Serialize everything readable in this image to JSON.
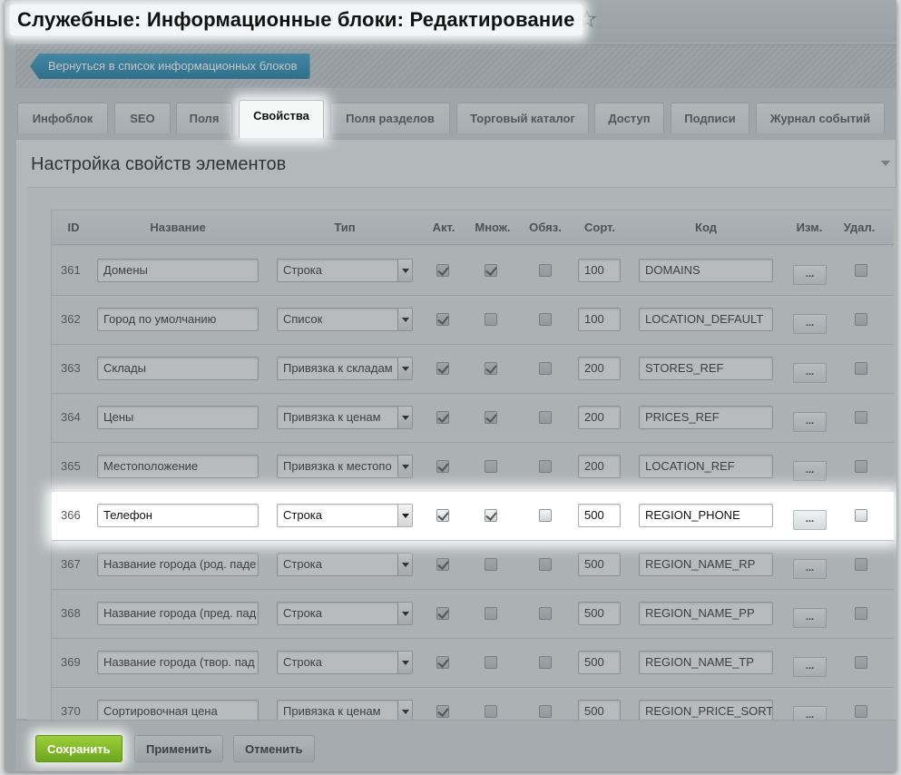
{
  "title": "Служебные: Информационные блоки: Редактирование",
  "back_button": "Вернуться в список информационных блоков",
  "tabs": [
    {
      "label": "Инфоблок",
      "active": false
    },
    {
      "label": "SEO",
      "active": false
    },
    {
      "label": "Поля",
      "active": false
    },
    {
      "label": "Свойства",
      "active": true
    },
    {
      "label": "Поля разделов",
      "active": false
    },
    {
      "label": "Торговый каталог",
      "active": false
    },
    {
      "label": "Доступ",
      "active": false
    },
    {
      "label": "Подписи",
      "active": false
    },
    {
      "label": "Журнал событий",
      "active": false
    }
  ],
  "section_title": "Настройка свойств элементов",
  "table": {
    "headers": {
      "id": "ID",
      "name": "Название",
      "type": "Тип",
      "active": "Акт.",
      "multiple": "Множ.",
      "required": "Обяз.",
      "sort": "Сорт.",
      "code": "Код",
      "edit": "Изм.",
      "delete": "Удал."
    },
    "rows": [
      {
        "id": "361",
        "name": "Домены",
        "type": "Строка",
        "active": true,
        "multiple": true,
        "required": false,
        "sort": "100",
        "code": "DOMAINS",
        "edit": "...",
        "delete": false
      },
      {
        "id": "362",
        "name": "Город по умолчанию",
        "type": "Список",
        "active": true,
        "multiple": false,
        "required": false,
        "sort": "100",
        "code": "LOCATION_DEFAULT",
        "edit": "...",
        "delete": false
      },
      {
        "id": "363",
        "name": "Склады",
        "type": "Привязка к складам",
        "active": true,
        "multiple": true,
        "required": false,
        "sort": "200",
        "code": "STORES_REF",
        "edit": "...",
        "delete": false
      },
      {
        "id": "364",
        "name": "Цены",
        "type": "Привязка к ценам",
        "active": true,
        "multiple": true,
        "required": false,
        "sort": "200",
        "code": "PRICES_REF",
        "edit": "...",
        "delete": false
      },
      {
        "id": "365",
        "name": "Местоположение",
        "type": "Привязка к местопо",
        "active": true,
        "multiple": false,
        "required": false,
        "sort": "200",
        "code": "LOCATION_REF",
        "edit": "...",
        "delete": false
      },
      {
        "id": "366",
        "name": "Телефон",
        "type": "Строка",
        "active": true,
        "multiple": true,
        "required": false,
        "sort": "500",
        "code": "REGION_PHONE",
        "edit": "...",
        "delete": false,
        "highlighted": true
      },
      {
        "id": "367",
        "name": "Название города (род. паде",
        "type": "Строка",
        "active": true,
        "multiple": false,
        "required": false,
        "sort": "500",
        "code": "REGION_NAME_RP",
        "edit": "...",
        "delete": false
      },
      {
        "id": "368",
        "name": "Название города (пред. пад",
        "type": "Строка",
        "active": true,
        "multiple": false,
        "required": false,
        "sort": "500",
        "code": "REGION_NAME_PP",
        "edit": "...",
        "delete": false
      },
      {
        "id": "369",
        "name": "Название города (твор. пад",
        "type": "Строка",
        "active": true,
        "multiple": false,
        "required": false,
        "sort": "500",
        "code": "REGION_NAME_TP",
        "edit": "...",
        "delete": false
      },
      {
        "id": "370",
        "name": "Сортировочная цена",
        "type": "Привязка к ценам",
        "active": true,
        "multiple": false,
        "required": false,
        "sort": "500",
        "code": "REGION_PRICE_SORT",
        "edit": "...",
        "delete": false
      }
    ]
  },
  "footer": {
    "save": "Сохранить",
    "apply": "Применить",
    "cancel": "Отменить"
  }
}
